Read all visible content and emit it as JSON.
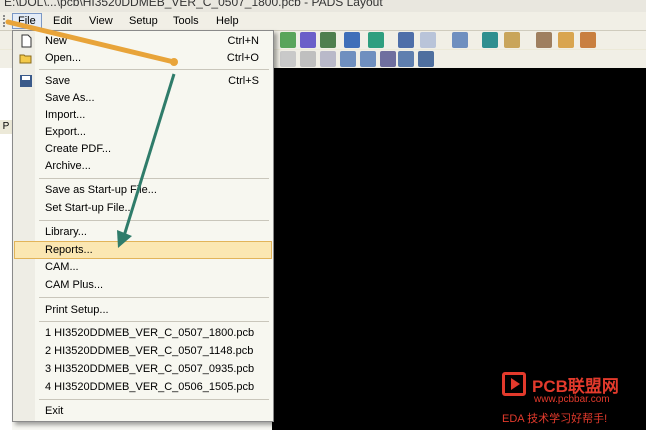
{
  "window": {
    "title": "E:\\DOL\\...\\pcb\\HI3520DDMEB_VER_C_0507_1800.pcb - PADS Layout"
  },
  "menubar": {
    "items": [
      {
        "label": "File",
        "active": true
      },
      {
        "label": "Edit"
      },
      {
        "label": "View"
      },
      {
        "label": "Setup"
      },
      {
        "label": "Tools"
      },
      {
        "label": "Help"
      }
    ]
  },
  "left_panel": {
    "label": "P"
  },
  "file_menu": {
    "new": {
      "label": "New",
      "shortcut": "Ctrl+N"
    },
    "open": {
      "label": "Open...",
      "shortcut": "Ctrl+O"
    },
    "save": {
      "label": "Save",
      "shortcut": "Ctrl+S"
    },
    "save_as": {
      "label": "Save As..."
    },
    "import": {
      "label": "Import..."
    },
    "export": {
      "label": "Export..."
    },
    "create_pdf": {
      "label": "Create PDF..."
    },
    "archive": {
      "label": "Archive..."
    },
    "save_startup": {
      "label": "Save as Start-up File..."
    },
    "set_startup": {
      "label": "Set Start-up File..."
    },
    "library": {
      "label": "Library..."
    },
    "reports": {
      "label": "Reports...",
      "highlighted": true
    },
    "cam": {
      "label": "CAM..."
    },
    "cam_plus": {
      "label": "CAM Plus..."
    },
    "print_setup": {
      "label": "Print Setup..."
    },
    "recent": [
      "1 HI3520DDMEB_VER_C_0507_1800.pcb",
      "2 HI3520DDMEB_VER_C_0507_1148.pcb",
      "3 HI3520DDMEB_VER_C_0507_0935.pcb",
      "4 HI3520DDMEB_VER_C_0506_1505.pcb"
    ],
    "exit": {
      "label": "Exit"
    }
  },
  "watermark": {
    "brand": "PCB联盟网",
    "url": "www.pcbbar.com",
    "slogan": "EDA 技术学习好帮手!"
  },
  "colors": {
    "annotation_line": "#e8a43a",
    "annotation_arrow": "#2f7c6a",
    "highlight": "#fbe7b2",
    "canvas": "#000000",
    "brand": "#e33a2c"
  }
}
